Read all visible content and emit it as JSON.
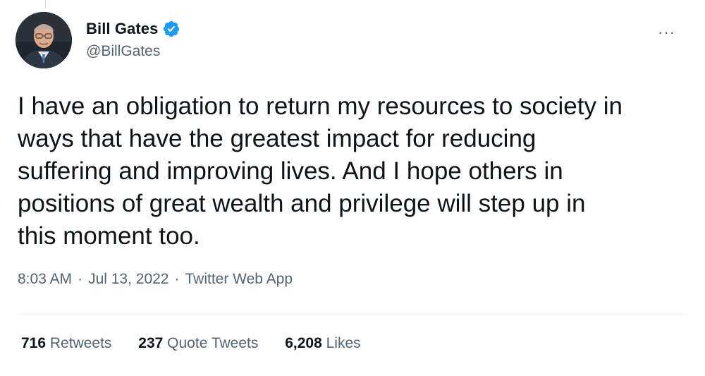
{
  "author": {
    "display_name": "Bill Gates",
    "handle": "@BillGates",
    "verified_icon": "verified-badge-icon",
    "avatar_icon": "profile-photo-avatar"
  },
  "tweet": {
    "lines": [
      "I have an obligation to return my resources to society in",
      "ways that have the greatest impact for reducing",
      "suffering and improving lives. And I hope others in",
      "positions of great wealth and privilege will step up in",
      "this moment too."
    ],
    "time": "8:03 AM",
    "date": "Jul 13, 2022",
    "source": "Twitter Web App",
    "separator": "·"
  },
  "stats": {
    "retweets_count": "716",
    "retweets_label": "Retweets",
    "quotes_count": "237",
    "quotes_label": "Quote Tweets",
    "likes_count": "6,208",
    "likes_label": "Likes"
  },
  "menu": {
    "more_label": "···"
  },
  "colors": {
    "accent_blue": "#1d9bf0",
    "text_primary": "#0f1419",
    "text_secondary": "#536471"
  }
}
